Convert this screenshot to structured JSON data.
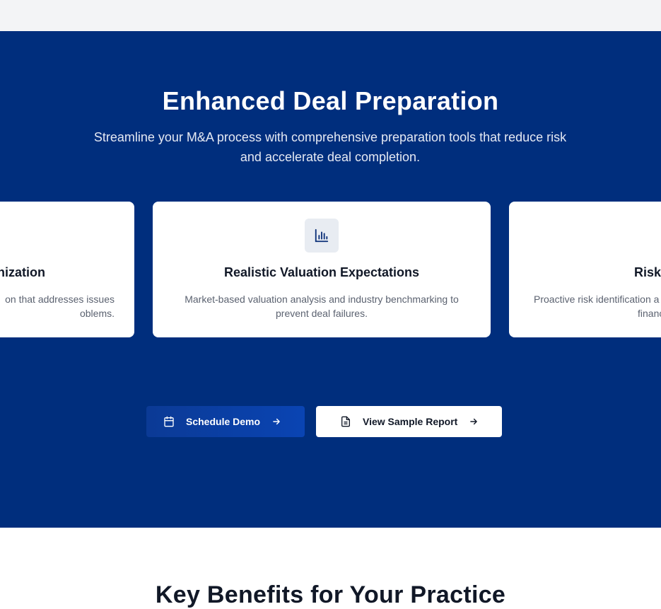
{
  "hero": {
    "title": "Enhanced Deal Preparation",
    "subtitle": "Streamline your M&A process with comprehensive preparation tools that reduce risk and accelerate deal completion."
  },
  "cards": {
    "left": {
      "title": "nization",
      "desc_line1": "on that addresses issues",
      "desc_line2": "oblems."
    },
    "middle": {
      "icon": "bar-chart-icon",
      "title": "Realistic Valuation Expectations",
      "desc": "Market-based valuation analysis and industry benchmarking to prevent deal failures."
    },
    "right": {
      "title": "Risk",
      "desc_line1": "Proactive risk identification a",
      "desc_line2": "financ"
    }
  },
  "buttons": {
    "primary": {
      "label": "Schedule Demo",
      "icon": "calendar-icon"
    },
    "secondary": {
      "label": "View Sample Report",
      "icon": "document-icon"
    }
  },
  "benefits": {
    "title": "Key Benefits for Your Practice"
  },
  "colors": {
    "hero_bg": "#002e7d",
    "primary_button": "#0a44b3",
    "top_bar": "#f3f4f6"
  }
}
